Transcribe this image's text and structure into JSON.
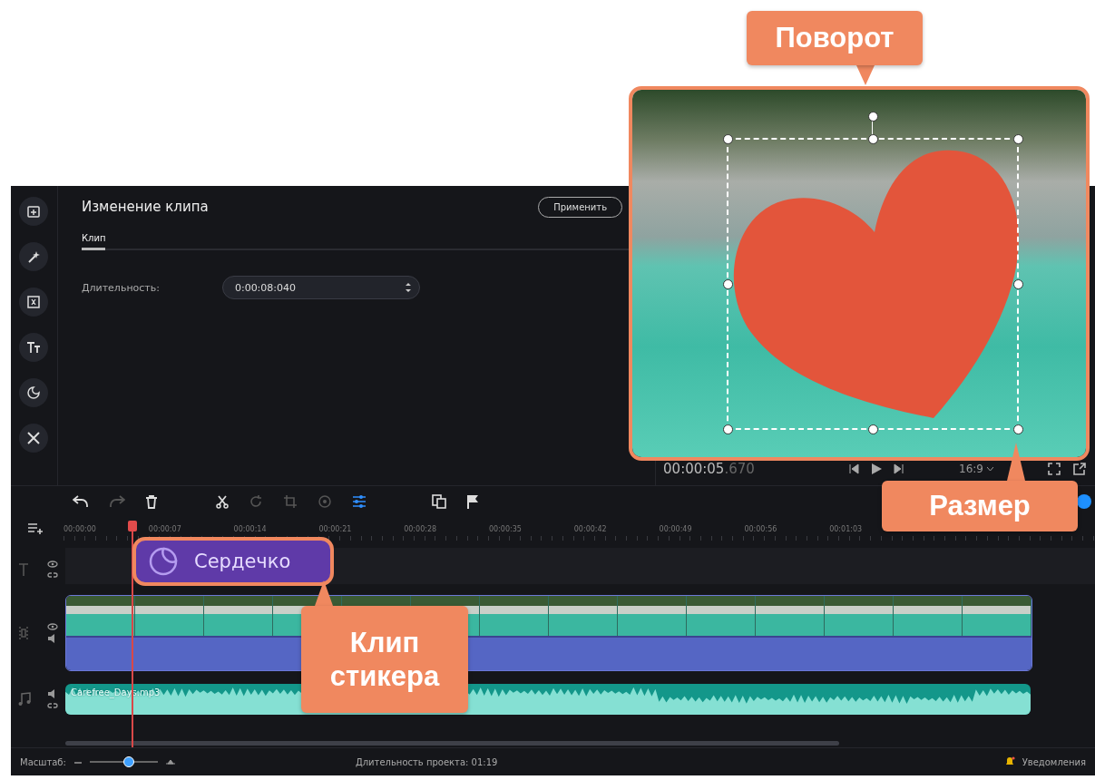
{
  "panel": {
    "title": "Изменение клипа",
    "apply_button": "Применить",
    "tabs": [
      {
        "label": "Клип",
        "selected": true
      }
    ],
    "field_label": "Длительность:",
    "field_value": "0:00:08:040"
  },
  "preview": {
    "time": "00:00:05",
    "time_ms": ".670",
    "aspect": "16:9"
  },
  "ruler": [
    "00:00:00",
    "00:00:07",
    "00:00:14",
    "00:00:21",
    "00:00:28",
    "00:00:35",
    "00:00:42",
    "00:00:49",
    "00:00:56",
    "00:01:03"
  ],
  "tracks": {
    "sticker_clip": "Сердечко",
    "audio_clip": "Carefree_Days.mp3"
  },
  "status_bar": {
    "zoom_label": "Масштаб:",
    "zoom_slider": {
      "level": 0.57
    },
    "duration": "Длительность проекта: 01:19",
    "notifications": "Уведомления"
  },
  "callouts": [
    {
      "text": "Поворот"
    },
    {
      "text": "Размер"
    },
    {
      "text": "Клип стикера"
    }
  ]
}
